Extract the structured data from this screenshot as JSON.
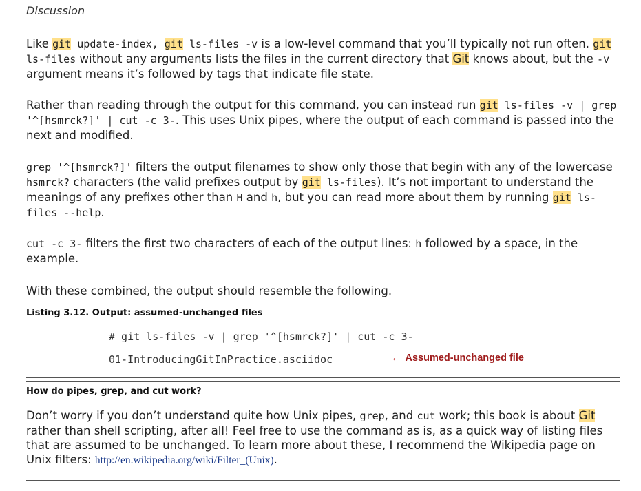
{
  "section_label": "Discussion",
  "p1": {
    "like": "Like ",
    "git1": "git",
    "cmd1": " update-index, ",
    "git2": "git",
    "cmd2": " ls-files -v",
    "t1": " is a low-level command that you’ll typically not run often. ",
    "git3": "git",
    "cmd3": "ls-files",
    "t2": " without any arguments lists the files in the current directory that ",
    "Git": "Git",
    "t3": " knows about, but the ",
    "cmd4": "-v",
    "t4": "argument means it’s followed by tags that indicate file state."
  },
  "p2": {
    "t1": "Rather than reading through the output for this command, you can instead run ",
    "git": "git",
    "cmd1": " ls-files -v | grep",
    "cmd2": "'^[hsmrck?]' | cut -c 3-",
    "t2": ". This uses Unix pipes, where the output of each command is passed into the",
    "t3": "next and modified."
  },
  "p3": {
    "cmd1": "grep '^[hsmrck?]'",
    "t1": " filters the output filenames to show only those that begin with any of the lowercase",
    "cmd2": "hsmrck?",
    "t2": " characters (the valid prefixes output by ",
    "git1": "git",
    "cmd3": " ls-files",
    "t3": "). It’s not important to understand the",
    "t4": "meanings of any prefixes other than ",
    "H": "H",
    "and": " and ",
    "h": "h",
    "t5": ", but you can read more about them by running ",
    "git2": "git",
    "cmd4": " ls-",
    "cmd5": "files --help",
    "t6": "."
  },
  "p4": {
    "cmd1": "cut -c 3-",
    "t1": " filters the first two characters of each of the output lines: ",
    "h": "h",
    "t2": " followed by a space, in the",
    "t3": "example."
  },
  "p5": "With these combined, the output should resemble the following.",
  "listing": {
    "caption": "Listing 3.12. Output: assumed-unchanged files",
    "line1": "# git ls-files -v | grep '^[hsmrck?]' | cut -c 3-",
    "line2": "01-IntroducingGitInPractice.asciidoc",
    "annotation": "Assumed-unchanged file",
    "arrow": "←"
  },
  "sidebar": {
    "title": "How do pipes, grep, and cut work?",
    "t1": "Don’t worry if you don’t understand quite how Unix pipes, ",
    "grep": "grep",
    "t2": ", and ",
    "cut": "cut",
    "t3": " work; this book is about ",
    "Git": "Git",
    "t4": "rather than shell scripting, after all! Feel free to use the command as is, as a quick way of listing files",
    "t5": "that are assumed to be unchanged. To learn more about these, I recommend the Wikipedia page on",
    "t6": "Unix filters: ",
    "link": "http://en.wikipedia.org/wiki/Filter_(Unix)",
    "t7": "."
  }
}
